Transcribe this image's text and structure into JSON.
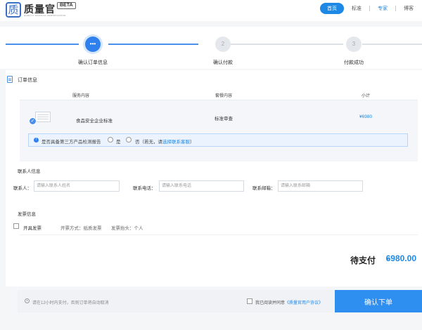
{
  "header": {
    "logo_char": "质",
    "brand_name": "质量官",
    "brand_badge": "BETA",
    "brand_sub": "QUALITY OFFICIAL CERTIFICATION",
    "nav": [
      {
        "label": "首页",
        "active": true
      },
      {
        "label": "标准",
        "active": false
      },
      {
        "label": "专家",
        "active": false
      },
      {
        "label": "博客",
        "active": false
      }
    ]
  },
  "steps": [
    {
      "num": "•••",
      "label": "确认订单信息",
      "state": "current"
    },
    {
      "num": "2",
      "label": "确认付款",
      "state": "pending"
    },
    {
      "num": "3",
      "label": "付款成功",
      "state": "pending"
    }
  ],
  "order": {
    "section_title": "订单信息",
    "columns": {
      "service": "服务内容",
      "plan": "套餐内容",
      "subtotal": "小计"
    },
    "item": {
      "name": "食品安全企业标准",
      "plan": "标准审查",
      "price": "¥6980"
    },
    "tip": {
      "question": "是否具备第三方产品检测报告",
      "yes": "是",
      "no_prefix": "否（若无，请",
      "no_link": "选择联系客服",
      "no_suffix": "）"
    }
  },
  "contact": {
    "section_title": "联系人信息",
    "name_label": "联系人：",
    "name_placeholder": "请输入联系人姓名",
    "phone_label": "联系电话：",
    "phone_placeholder": "请输入联系电话",
    "email_label": "联系邮箱：",
    "email_placeholder": "请输入联系邮箱"
  },
  "invoice": {
    "section_title": "发票信息",
    "checkbox_label": "开具发票",
    "method": "开票方式：纸质发票",
    "header": "发票抬头：个人"
  },
  "payment": {
    "due_label": "待支付",
    "currency": "¥",
    "amount": "6980.00"
  },
  "footer": {
    "note": "请在12小时内支付，否则订单将自动取消",
    "agree_prefix": "我已阅读并同意",
    "agree_link": "《质量官用户协议》",
    "confirm_label": "确认下单"
  },
  "colors": {
    "accent": "#2f8ff0",
    "link": "#1e88e5"
  }
}
